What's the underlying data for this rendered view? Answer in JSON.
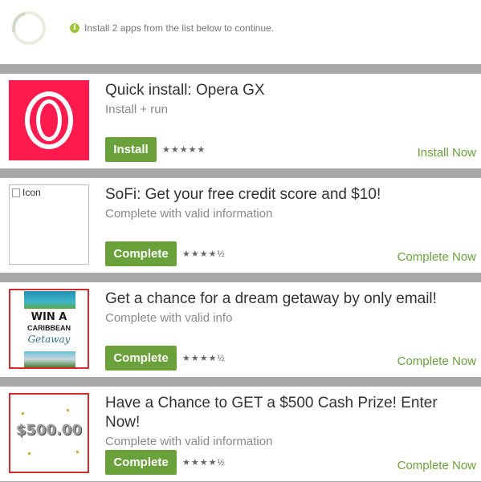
{
  "header": {
    "message": "Install 2 apps from the list below to continue.",
    "info_glyph": "i"
  },
  "offers": [
    {
      "title": "Quick install: Opera GX",
      "subtitle": "Install + run",
      "button": "Install",
      "stars": "★★★★★",
      "action": "Install Now"
    },
    {
      "title": "SoFi: Get your free credit score and $10!",
      "subtitle": "Complete with valid information",
      "button": "Complete",
      "stars": "★★★★½",
      "action": "Complete Now",
      "image_alt": "Icon"
    },
    {
      "title": "Get a chance for a dream getaway by only email!",
      "subtitle": "Complete with valid info",
      "button": "Complete",
      "stars": "★★★★½",
      "action": "Complete Now",
      "image_lines": [
        "WIN A",
        "CARIBBEAN",
        "Getaway"
      ]
    },
    {
      "title": "Have a Chance to GET a $500 Cash Prize! Enter Now!",
      "subtitle": "Complete with valid information",
      "button": "Complete",
      "stars": "★★★★½",
      "action": "Complete Now",
      "image_text": "$500.00"
    }
  ],
  "colors": {
    "accent": "#6aa13a",
    "opera": "#ff1a4d",
    "info": "#9ec43a"
  }
}
